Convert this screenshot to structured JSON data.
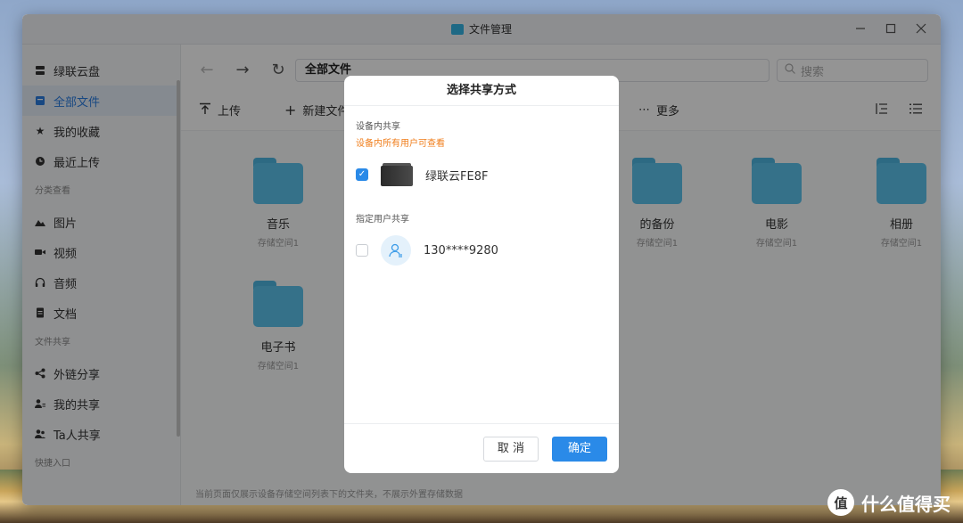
{
  "window": {
    "title": "文件管理",
    "controls": [
      "minimize",
      "maximize",
      "close"
    ]
  },
  "sidebar": {
    "items": [
      {
        "label": "绿联云盘",
        "icon": "server-icon"
      },
      {
        "label": "全部文件",
        "icon": "file-icon",
        "active": true
      }
    ],
    "items2": [
      {
        "label": "我的收藏",
        "icon": "star-icon"
      },
      {
        "label": "最近上传",
        "icon": "clock-icon"
      }
    ],
    "group_category": "分类查看",
    "category_items": [
      {
        "label": "图片",
        "icon": "image-icon"
      },
      {
        "label": "视频",
        "icon": "video-icon"
      },
      {
        "label": "音频",
        "icon": "headphones-icon"
      },
      {
        "label": "文档",
        "icon": "document-icon"
      }
    ],
    "group_share": "文件共享",
    "share_items": [
      {
        "label": "外链分享",
        "icon": "share-icon"
      },
      {
        "label": "我的共享",
        "icon": "users-icon"
      },
      {
        "label": "Ta人共享",
        "icon": "people-icon"
      }
    ],
    "group_quick": "快捷入口"
  },
  "toolbar": {
    "path": "全部文件",
    "search_placeholder": "搜索",
    "upload_label": "上传",
    "new_folder_label": "新建文件夹",
    "more_label": "更多"
  },
  "folders": [
    {
      "name": "音乐",
      "location": "存储空间1"
    },
    {
      "name": "的备份",
      "location": "存储空间1"
    },
    {
      "name": "电影",
      "location": "存储空间1"
    },
    {
      "name": "相册",
      "location": "存储空间1"
    },
    {
      "name": "电子书",
      "location": "存储空间1"
    }
  ],
  "status_text": "当前页面仅展示设备存储空间列表下的文件夹，不展示外置存储数据",
  "dialog": {
    "title": "选择共享方式",
    "device_section": "设备内共享",
    "device_hint": "设备内所有用户可查看",
    "device_name": "绿联云FE8F",
    "device_checked": true,
    "user_section": "指定用户共享",
    "user_name": "130****9280",
    "user_checked": false,
    "cancel_label": "取 消",
    "ok_label": "确定"
  },
  "watermark": {
    "glyph": "值",
    "text": "什么值得买"
  },
  "colors": {
    "accent": "#2a8ae8",
    "hint": "#f07d1a",
    "folder": "#5cc3ec"
  }
}
